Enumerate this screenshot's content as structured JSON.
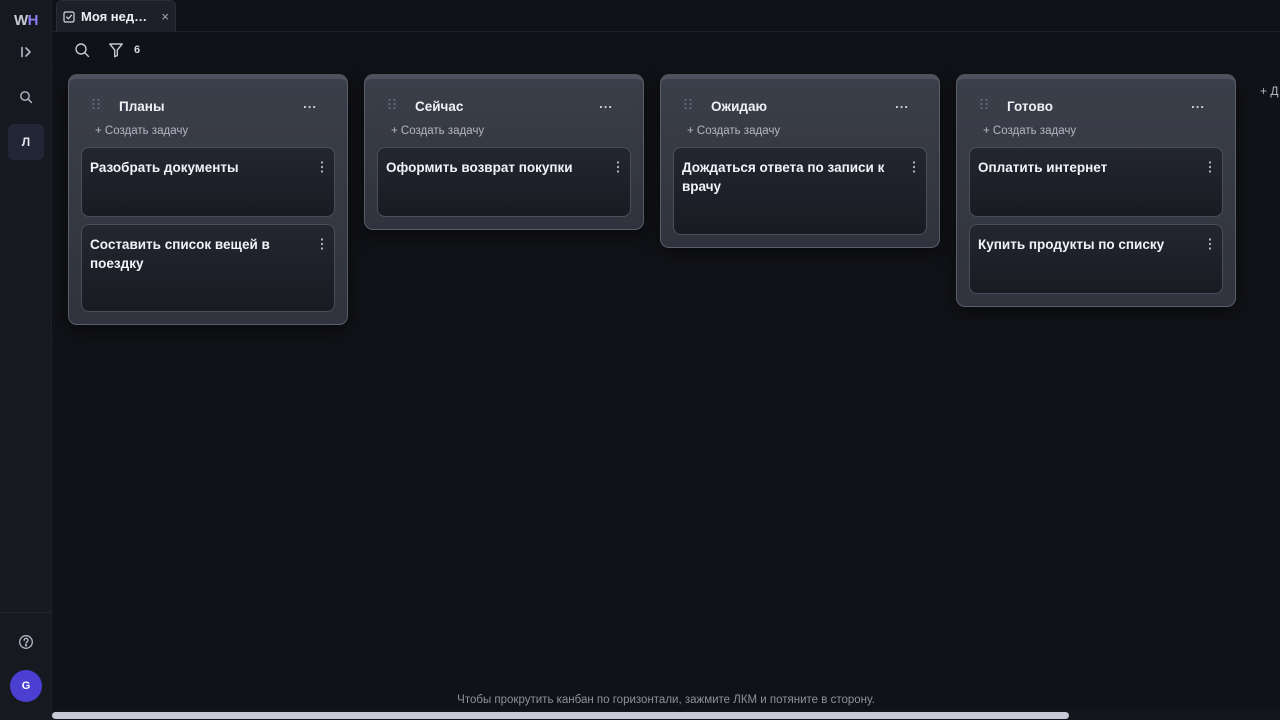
{
  "app": {
    "logo_w": "W",
    "logo_h": "H",
    "workspace_letter": "Л",
    "avatar_letter": "G"
  },
  "tab": {
    "label": "Моя нед…",
    "close": "×"
  },
  "toolbar": {
    "filter_count": "6"
  },
  "columns": [
    {
      "title": "Планы",
      "more": "...",
      "create": "+ Создать задачу",
      "cards": [
        "Разобрать документы",
        "Составить список вещей в поездку"
      ]
    },
    {
      "title": "Сейчас",
      "more": "...",
      "create": "+ Создать задачу",
      "cards": [
        "Оформить возврат покупки"
      ]
    },
    {
      "title": "Ожидаю",
      "more": "...",
      "create": "+ Создать задачу",
      "cards": [
        "Дождаться ответа по записи к врачу"
      ]
    },
    {
      "title": "Готово",
      "more": "...",
      "create": "+ Создать задачу",
      "cards": [
        "Оплатить интернет",
        "Купить продукты по списку"
      ]
    }
  ],
  "add_column": "+ Д",
  "hint": "Чтобы прокрутить канбан по горизонтали, зажмите ЛКМ и потяните в сторону.",
  "icons": [
    "expand-sidebar-icon",
    "search-icon",
    "help-icon",
    "checkbox-icon",
    "filter-icon",
    "drag-handle-icon",
    "kebab-icon"
  ],
  "colors": {
    "background": "#111217",
    "sidebar": "#171921",
    "column": "#363a45",
    "card": "#1e2029",
    "avatar": "#4a3fd1",
    "logo_accent": "#8b7cf2"
  }
}
